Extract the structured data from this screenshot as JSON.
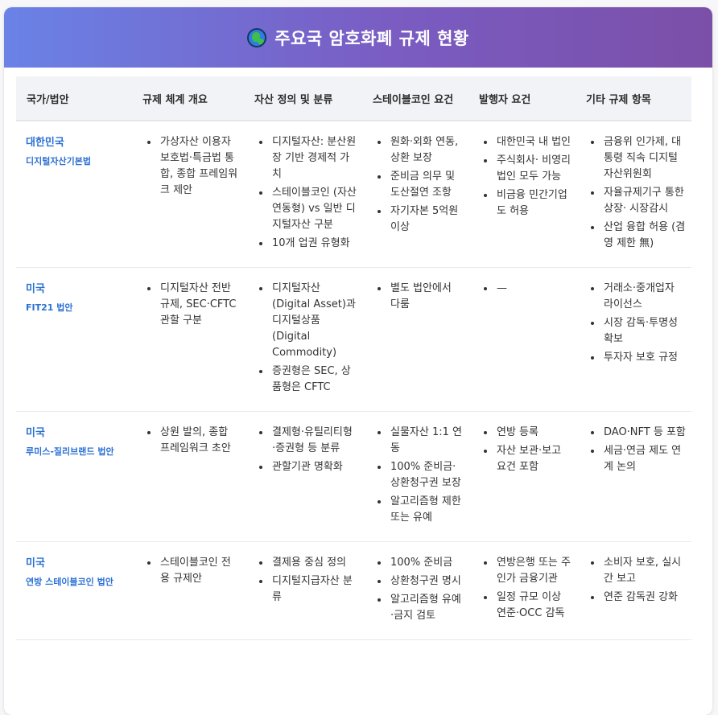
{
  "header": {
    "title": "주요국 암호화폐 규제 현황",
    "icon": "globe-icon"
  },
  "table": {
    "columns": [
      "국가/법안",
      "규제 체계 개요",
      "자산 정의 및 분류",
      "스테이블코인 요건",
      "발행자 요건",
      "기타 규제 항목"
    ],
    "rows": [
      {
        "country": "대한민국",
        "law": "디지털자산기본법",
        "cells": [
          [
            "가상자산 이용자보호법·특금법 통합, 종합 프레임워크 제안"
          ],
          [
            "디지털자산: 분산원장 기반 경제적 가치",
            "스테이블코인 (자산연동형) vs 일반 디지털자산 구분",
            "10개 업권 유형화"
          ],
          [
            "원화·외화 연동, 상환 보장",
            "준비금 의무 및 도산절연 조항",
            "자기자본 5억원 이상"
          ],
          [
            "대한민국 내 법인",
            "주식회사· 비영리법인 모두 가능",
            "비금융 민간기업도 허용"
          ],
          [
            "금융위 인가제, 대통령 직속 디지털자산위원회",
            "자율규제기구 통한 상장· 시장감시",
            "산업 융합 허용 (겸영 제한 無)"
          ]
        ]
      },
      {
        "country": "미국",
        "law": "FIT21 법안",
        "cells": [
          [
            "디지털자산 전반 규제, SEC·CFTC 관할 구분"
          ],
          [
            "디지털자산 (Digital Asset)과 디지털상품 (Digital Commodity)",
            "증권형은 SEC, 상품형은 CFTC"
          ],
          [
            "별도 법안에서 다룸"
          ],
          [
            "—"
          ],
          [
            "거래소·중개업자 라이선스",
            "시장 감독·투명성 확보",
            "투자자 보호 규정"
          ]
        ]
      },
      {
        "country": "미국",
        "law": "루미스-질리브랜드 법안",
        "cells": [
          [
            "상원 발의, 종합 프레임워크 초안"
          ],
          [
            "결제형·유틸리티형 ·증권형 등 분류",
            "관할기관 명확화"
          ],
          [
            "실물자산 1:1 연동",
            "100% 준비금· 상환청구권 보장",
            "알고리즘형 제한 또는 유예"
          ],
          [
            "연방 등록",
            "자산 보관·보고 요건 포함"
          ],
          [
            "DAO·NFT 등 포함",
            "세금·연금 제도 연계 논의"
          ]
        ]
      },
      {
        "country": "미국",
        "law": "연방 스테이블코인 법안",
        "cells": [
          [
            "스테이블코인 전용 규제안"
          ],
          [
            "결제용 중심 정의",
            "디지털지급자산 분류"
          ],
          [
            "100% 준비금",
            "상환청구권 명시",
            "알고리즘형 유예·금지 검토"
          ],
          [
            "연방은행 또는 주 인가 금융기관",
            "일정 규모 이상 연준·OCC 감독"
          ],
          [
            "소비자 보호, 실시간 보고",
            "연준 감독권 강화"
          ]
        ]
      }
    ]
  }
}
